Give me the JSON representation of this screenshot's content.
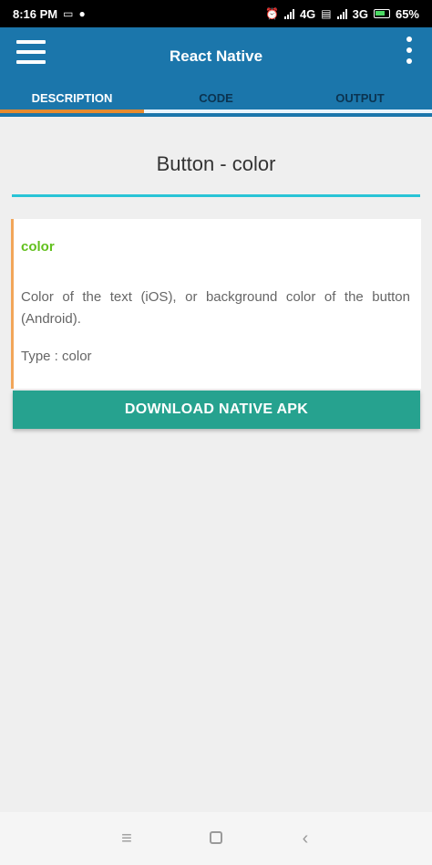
{
  "status_bar": {
    "time": "8:16 PM",
    "network_label_1": "4G",
    "network_label_2": "3G",
    "battery": "65%"
  },
  "app_bar": {
    "title": "React Native"
  },
  "tabs": [
    {
      "label": "DESCRIPTION",
      "active": true
    },
    {
      "label": "CODE",
      "active": false
    },
    {
      "label": "OUTPUT",
      "active": false
    }
  ],
  "content": {
    "title": "Button - color",
    "property_name": "color",
    "description": "Color of the text (iOS), or background color of the button (Android).",
    "type": "Type : color"
  },
  "download_button": {
    "label": "DOWNLOAD NATIVE APK"
  },
  "colors": {
    "app_bar": "#1b76ab",
    "tab_indicator": "#e68a2e",
    "title_rule": "#29c4d6",
    "property_name": "#62c01e",
    "button": "#26a28f"
  }
}
